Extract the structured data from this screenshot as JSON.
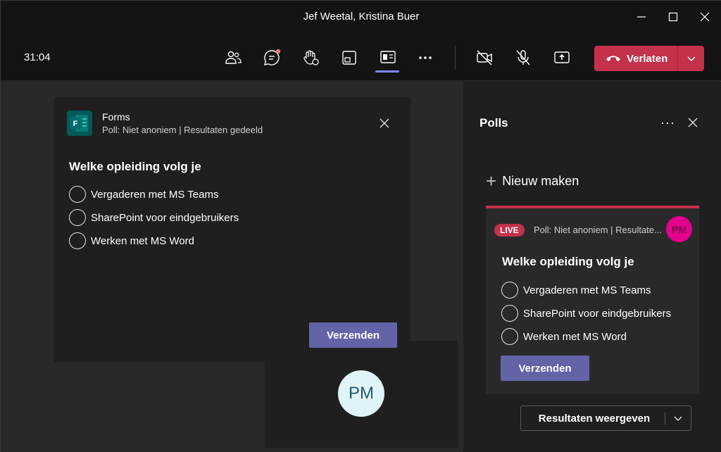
{
  "window": {
    "title": "Jef Weetal, Kristina Buer"
  },
  "toolbar": {
    "timer": "31:04",
    "icons": [
      "people-icon",
      "chat-icon",
      "raise-hand-icon",
      "breakout-icon",
      "apps-icon",
      "more-icon",
      "camera-off-icon",
      "mic-off-icon",
      "share-icon"
    ],
    "leave_label": "Verlaten"
  },
  "stage_poll": {
    "app_name": "Forms",
    "subtitle": "Poll: Niet anoniem | Resultaten gedeeld",
    "question": "Welke opleiding volg je",
    "options": [
      "Vergaderen met MS Teams",
      "SharePoint voor eindgebruikers",
      "Werken met MS Word"
    ],
    "submit_label": "Verzenden"
  },
  "participant": {
    "initials": "PM"
  },
  "panel": {
    "title": "Polls",
    "more_label": "···",
    "new_label": "Nieuw maken",
    "live_card": {
      "badge": "LIVE",
      "subtitle": "Poll: Niet anoniem | Resultate...",
      "avatar_initials": "PM",
      "question": "Welke opleiding volg je",
      "options": [
        "Vergaderen met MS Teams",
        "SharePoint voor eindgebruikers",
        "Werken met MS Word"
      ],
      "submit_label": "Verzenden",
      "results_label": "Resultaten weergeven"
    }
  },
  "colors": {
    "leave": "#c4314b",
    "accent": "#6264a7",
    "live": "#c4314b",
    "avatar_pink": "#e3008c"
  }
}
